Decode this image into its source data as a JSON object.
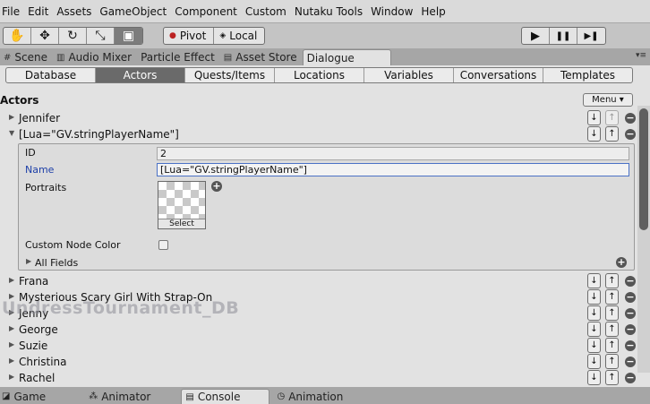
{
  "menubar": [
    "File",
    "Edit",
    "Assets",
    "GameObject",
    "Component",
    "Custom",
    "Nutaku Tools",
    "Window",
    "Help"
  ],
  "toolbar": {
    "tools": [
      {
        "name": "hand-tool",
        "glyph": "✋"
      },
      {
        "name": "move-tool",
        "glyph": "✥"
      },
      {
        "name": "rotate-tool",
        "glyph": "↻"
      },
      {
        "name": "scale-tool",
        "glyph": "⤡"
      },
      {
        "name": "rect-tool",
        "glyph": "▣"
      }
    ],
    "pivot_label": "Pivot",
    "local_label": "Local",
    "play_glyph": "▶",
    "pause_glyph": "❚❚",
    "step_glyph": "▶❚"
  },
  "doc_tabs": {
    "scene": "Scene",
    "audio_mixer": "Audio Mixer",
    "particle_effect": "Particle Effect",
    "asset_store": "Asset Store",
    "dialogue": "Dialogue",
    "window_controls": "▾≡"
  },
  "sub_tabs": [
    "Database",
    "Actors",
    "Quests/Items",
    "Locations",
    "Variables",
    "Conversations",
    "Templates"
  ],
  "sub_tabs_active": "Actors",
  "section": {
    "title": "Actors",
    "menu_label": "Menu ▾"
  },
  "actors": {
    "first": "Jennifer",
    "expanded": "[Lua=\"GV.stringPlayerName\"]",
    "rest": [
      "Frana",
      "Mysterious Scary Girl With Strap-On",
      "Jenny",
      "George",
      "Suzie",
      "Christina",
      "Rachel"
    ]
  },
  "detail": {
    "id_label": "ID",
    "id_value": "2",
    "name_label": "Name",
    "name_value": "[Lua=\"GV.stringPlayerName\"]",
    "portraits_label": "Portraits",
    "portrait_select": "Select",
    "custom_node_color_label": "Custom Node Color",
    "custom_node_color_checked": false,
    "all_fields_label": "All Fields"
  },
  "watermark": "UndressTournament_DB",
  "bottom_tabs": {
    "game": "Game",
    "animator": "Animator",
    "console": "Console",
    "animation": "Animation"
  }
}
